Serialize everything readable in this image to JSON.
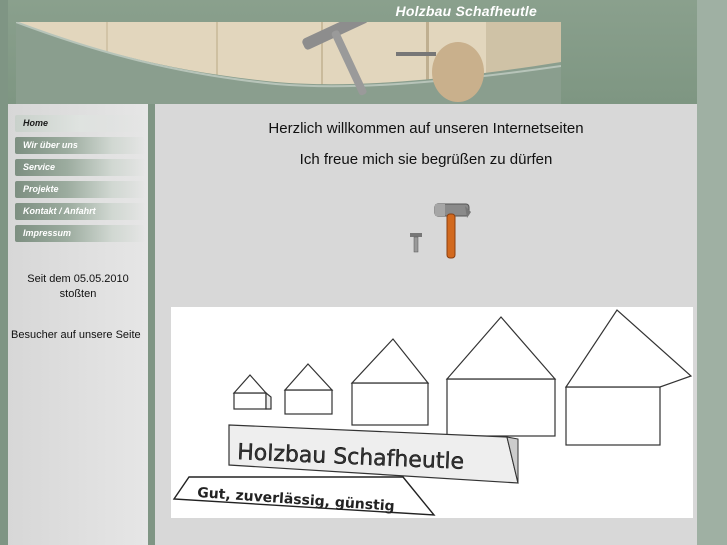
{
  "header": {
    "site_title": "Holzbau Schafheutle"
  },
  "nav": {
    "items": [
      {
        "label": "Home",
        "active": true
      },
      {
        "label": "Wir über uns",
        "active": false
      },
      {
        "label": "Service",
        "active": false
      },
      {
        "label": "Projekte",
        "active": false
      },
      {
        "label": "Kontakt / Anfahrt",
        "active": false
      },
      {
        "label": "Impressum",
        "active": false
      }
    ]
  },
  "sidebar": {
    "since_line1": "Seit dem 05.05.2010",
    "since_line2": "stoßten",
    "visitor_text": "Besucher auf unsere Seite"
  },
  "main": {
    "welcome_line1": "Herzlich willkommen auf unseren Internetseiten",
    "welcome_line2": "Ich freue mich sie begrüßen zu dürfen",
    "logo": {
      "company_name": "Holzbau Schafheutle",
      "slogan": "Gut, zuverlässig, günstig"
    }
  },
  "colors": {
    "frame_green": "#7f9584",
    "content_gray": "#d8d8d8",
    "sidebar_gray": "#e0e0e0",
    "hammer_handle": "#d2691e"
  },
  "icons": [
    "hammer-banner-icon",
    "hammer-icon",
    "nail-icon",
    "house-icon"
  ]
}
